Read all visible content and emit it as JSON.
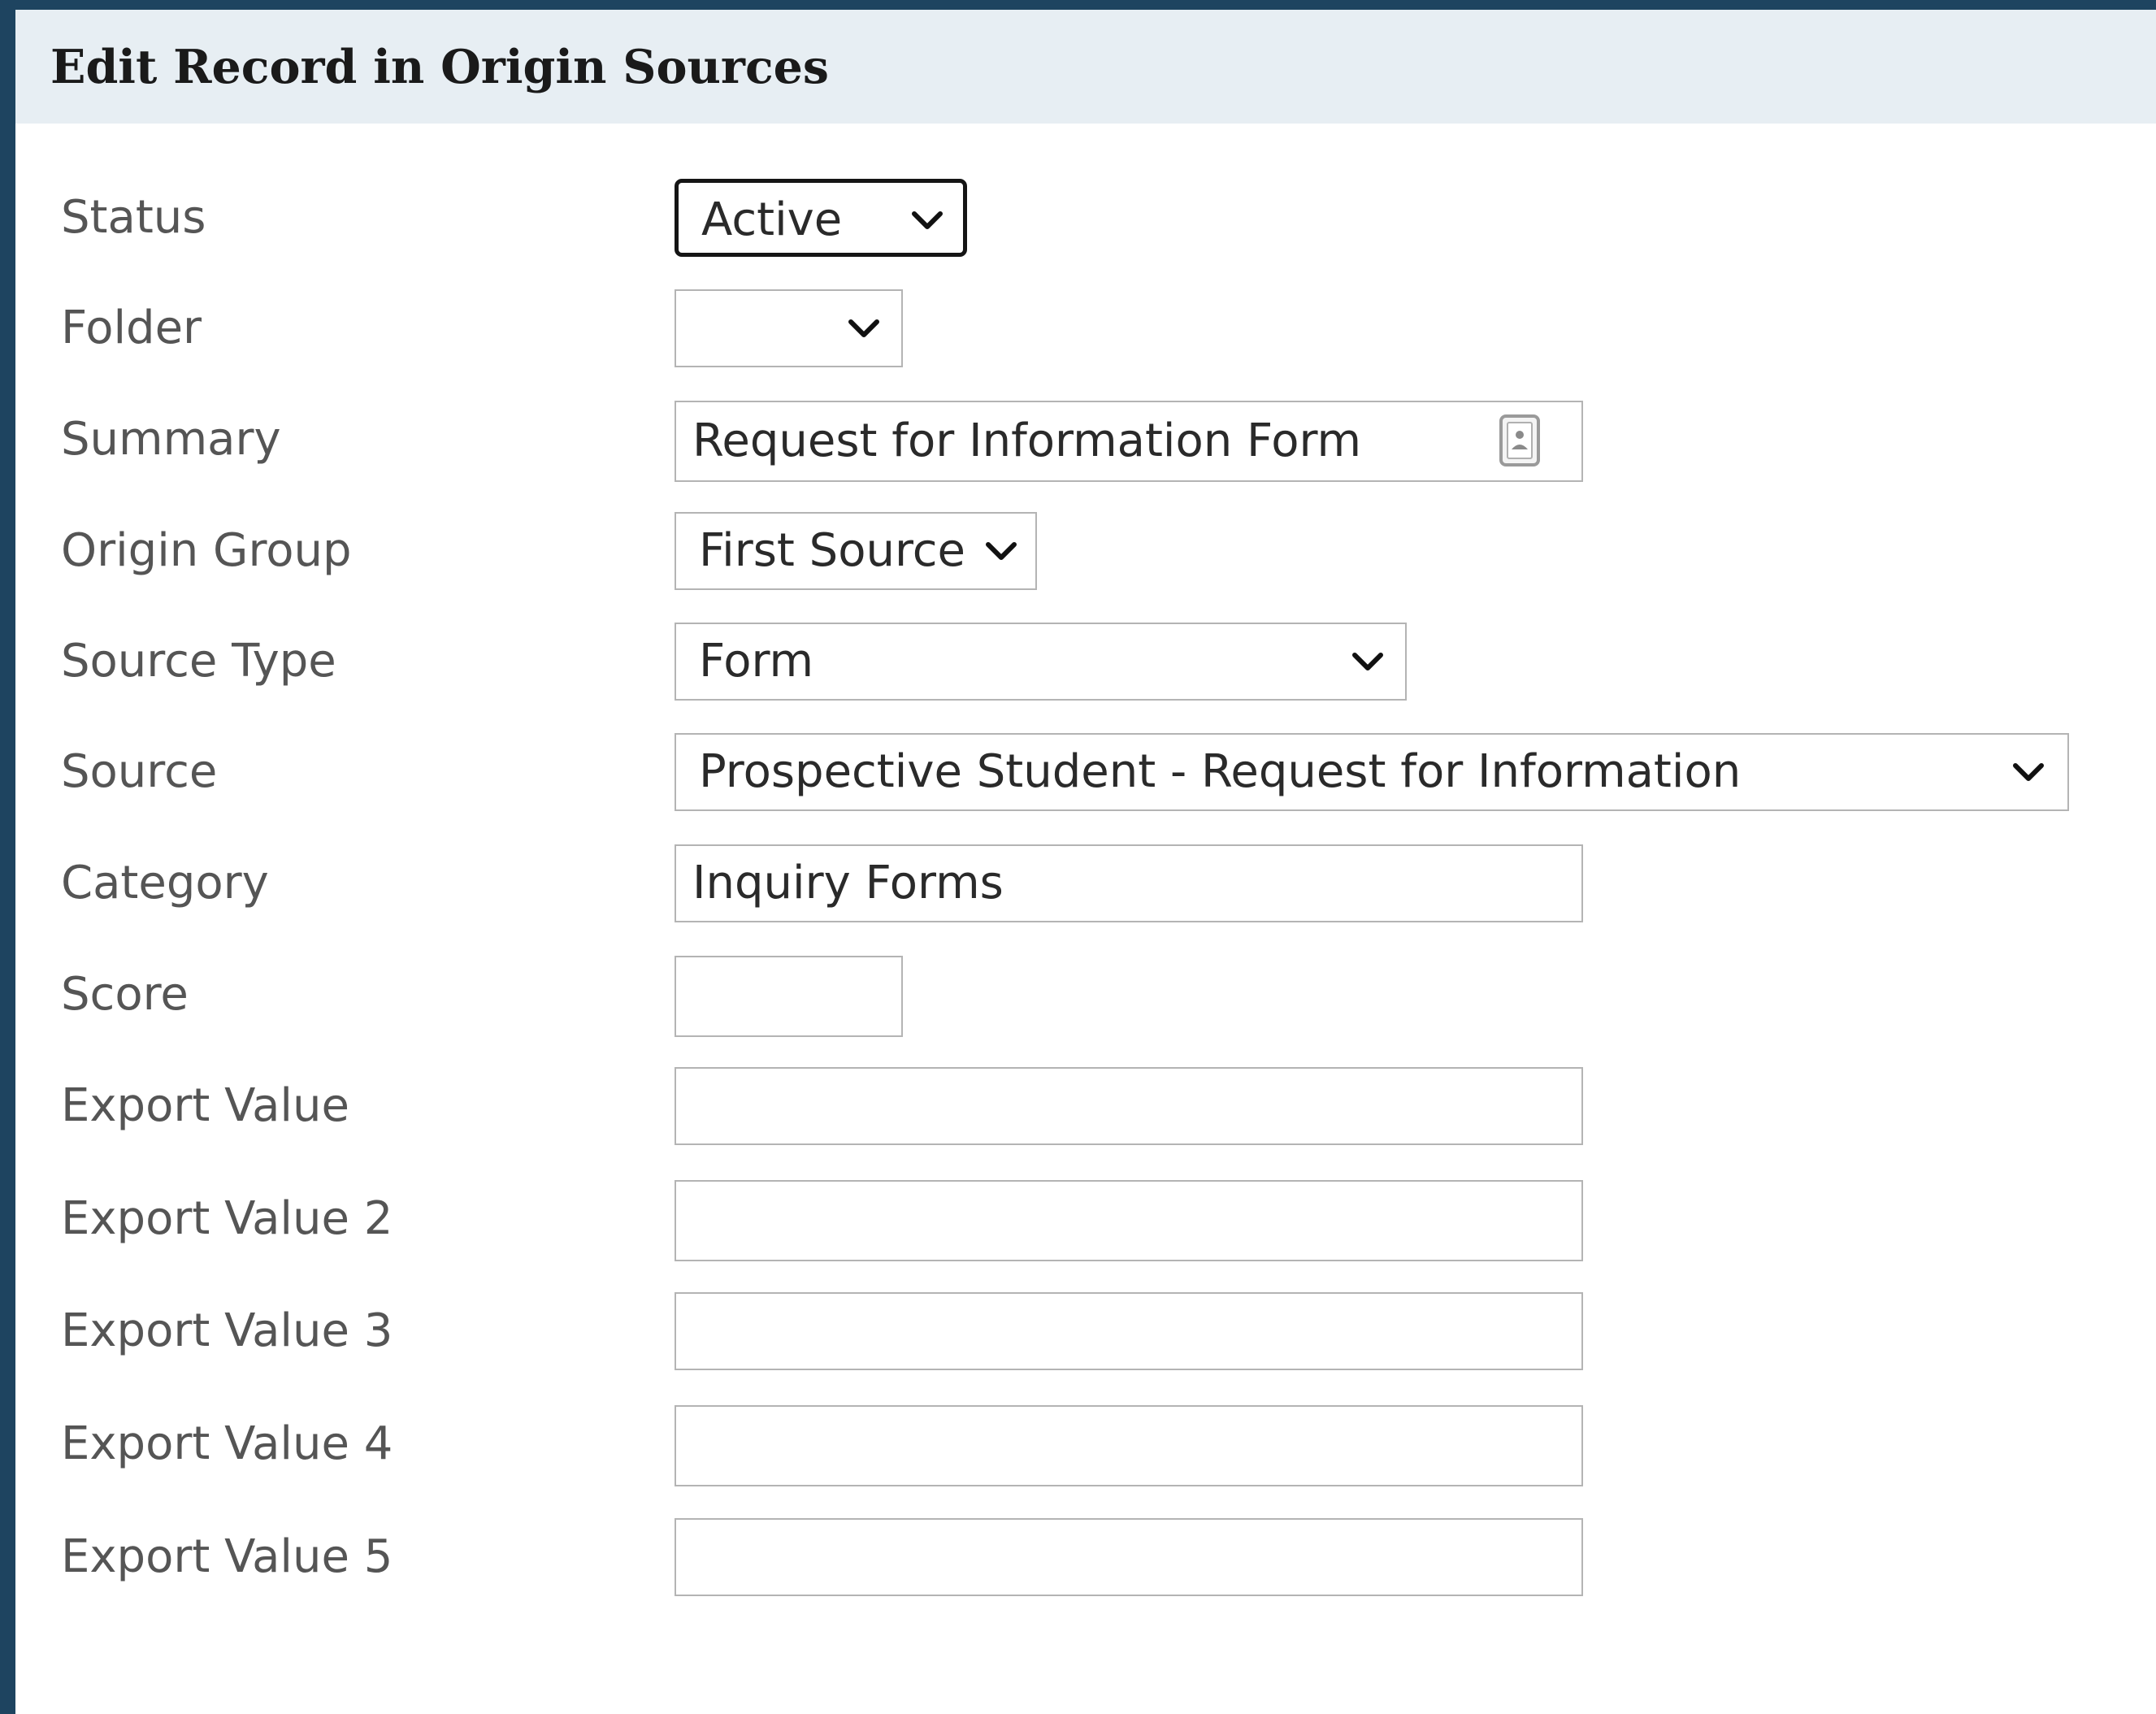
{
  "dialog": {
    "title": "Edit Record in Origin Sources"
  },
  "fields": {
    "status": {
      "label": "Status",
      "value": "Active"
    },
    "folder": {
      "label": "Folder",
      "value": ""
    },
    "summary": {
      "label": "Summary",
      "value": "Request for Information Form"
    },
    "origin_group": {
      "label": "Origin Group",
      "value": "First Source"
    },
    "source_type": {
      "label": "Source Type",
      "value": "Form"
    },
    "source": {
      "label": "Source",
      "value": "Prospective Student - Request for Information"
    },
    "category": {
      "label": "Category",
      "value": "Inquiry Forms"
    },
    "score": {
      "label": "Score",
      "value": ""
    },
    "export_value": {
      "label": "Export Value",
      "value": ""
    },
    "export_value_2": {
      "label": "Export Value 2",
      "value": ""
    },
    "export_value_3": {
      "label": "Export Value 3",
      "value": ""
    },
    "export_value_4": {
      "label": "Export Value 4",
      "value": ""
    },
    "export_value_5": {
      "label": "Export Value 5",
      "value": ""
    }
  },
  "icons": {
    "dropdown": "chevron-down-icon",
    "summary_field": "contact-card-icon"
  },
  "colors": {
    "frame": "#1e4460",
    "header_background": "#e7eef3",
    "label_text": "#555555",
    "field_border": "#b4b4b4",
    "focus_border": "#151515"
  }
}
